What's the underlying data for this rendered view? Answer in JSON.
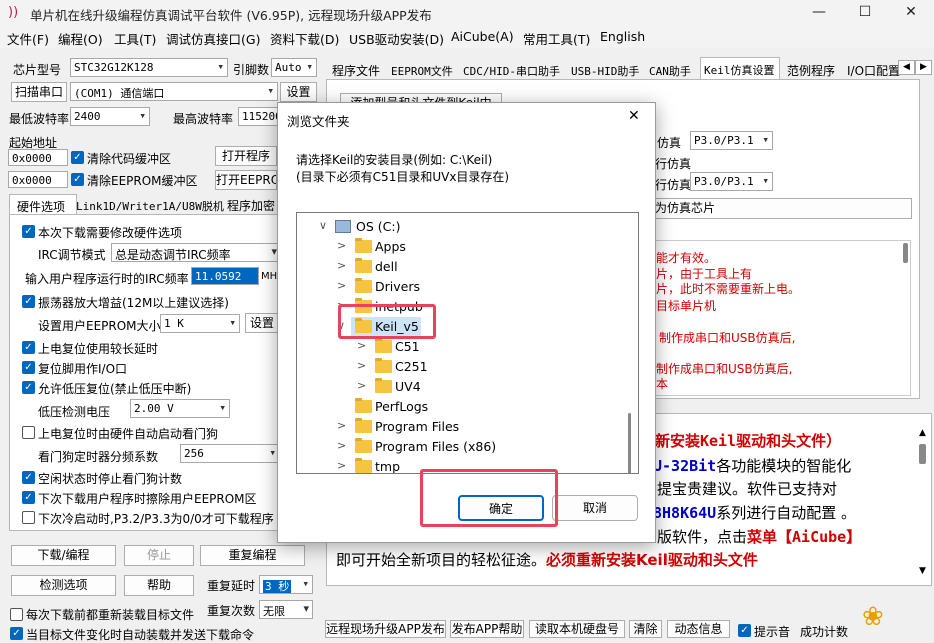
{
  "window": {
    "title": "单片机在线升级编程仿真调试平台软件 (V6.95P), 远程现场升级APP发布",
    "minimize": "—",
    "maximize": "☐",
    "close": "✕"
  },
  "menu": [
    "文件(F)",
    "编程(O)",
    "工具(T)",
    "调试仿真接口(G)",
    "资料下载(D)",
    "USB驱动安装(D)",
    "AiCube(A)",
    "常用工具(T)",
    "English"
  ],
  "left": {
    "chip_label": "芯片型号",
    "chip_value": "STC32G12K128",
    "pin_label": "引脚数",
    "pin_value": "Auto",
    "scan_button": "扫描串口",
    "port_value": "(COM1) 通信端口",
    "settings_button": "设置",
    "min_baud_label": "最低波特率",
    "min_baud": "2400",
    "max_baud_label": "最高波特率",
    "max_baud": "115200",
    "start_addr_label": "起始地址",
    "addr1": "0x0000",
    "clear_code": "清除代码缓冲区",
    "open_prog": "打开程序",
    "addr2": "0x0000",
    "clear_eeprom": "清除EEPROM缓冲区",
    "open_eeprom": "打开EEPRO",
    "tabs": [
      "硬件选项",
      "Link1D/Writer1A/U8W脱机",
      "程序加密"
    ],
    "opt_modify": "本次下载需要修改硬件选项",
    "irc_mode_label": "IRC调节模式",
    "irc_mode": "总是动态调节IRC频率",
    "irc_freq_label": "输入用户程序运行时的IRC频率",
    "irc_freq": "11.0592",
    "mhz": "MHz",
    "osc_gain": "振荡器放大增益(12M以上建议选择)",
    "eeprom_size_label": "设置用户EEPROM大小",
    "eeprom_size": "1  K",
    "eeprom_btn": "设置",
    "long_delay": "上电复位使用较长延时",
    "reset_io": "复位脚用作I/O口",
    "lvd_reset": "允许低压复位(禁止低压中断)",
    "lvd_volt_label": "低压检测电压",
    "lvd_volt": "2.00 V",
    "wdt_auto": "上电复位时由硬件自动启动看门狗",
    "wdt_div_label": "看门狗定时器分频系数",
    "wdt_div": "256",
    "idle_wdt": "空闲状态时停止看门狗计数",
    "erase_eeprom": "下次下载用户程序时擦除用户EEPROM区",
    "cold_boot": "下次冷启动时,P3.2/P3.3为0/0才可下载程序",
    "download_btn": "下载/编程",
    "stop_btn": "停止",
    "reprog_btn": "重复编程",
    "check_btn": "检测选项",
    "help_btn": "帮助",
    "repeat_delay_label": "重复延时",
    "repeat_delay": "3 秒",
    "repeat_count_label": "重复次数",
    "repeat_count": "无限",
    "reload_before": "每次下载前都重新装载目标文件",
    "auto_reload": "当目标文件变化时自动装载并发送下载命令"
  },
  "right": {
    "tabs": [
      "程序文件",
      "EEPROM文件",
      "CDC/HID-串口助手",
      "USB-HID助手",
      "CAN助手",
      "Keil仿真设置",
      "范例程序",
      "I/O口配置"
    ],
    "add_btn": "添加型号和头文件到Keil中",
    "emu_lbl1": "仿真",
    "emu_val1": "P3.0/P3.1",
    "emu_lbl2": "行仿真",
    "emu_lbl3": "行仿真",
    "emu_val3": "P3.0/P3.1",
    "set_emu": "为仿真芯片",
    "notes": [
      "能才有效。",
      "片，由于工具上有",
      "片，此时不需要重新上电。",
      "目标单片机",
      "制作成串口和USB仿真后,",
      "制作成串口和USB仿真后,",
      "本"
    ],
    "log_line1": "新安装Keil驱动和头文件）",
    "log_line2_a": "U-32Bit",
    "log_line2_b": "各功能模块的智能化",
    "log_line3": "提宝贵建议。软件已支持对",
    "log_line4_a": "8H8K64U",
    "log_line4_b": "系列进行自动配置 。",
    "log_line5_a": "版软件，点击",
    "log_line5_b": "菜单【AiCube】",
    "log_line6_a": "即可开始全新项目的轻松征途。",
    "log_line6_b": "必须重新安装Keil驱动和头文件",
    "bottom_btns": [
      "远程现场升级APP发布",
      "发布APP帮助",
      "读取本机硬盘号",
      "清除",
      "动态信息"
    ],
    "sound": "提示音",
    "success_label": "成功计数"
  },
  "dialog": {
    "title": "浏览文件夹",
    "close": "✕",
    "msg1": "请选择Keil的安装目录(例如: C:\\Keil)",
    "msg2": "(目录下必须有C51目录和UVx目录存在)",
    "tree": [
      {
        "label": "OS (C:)",
        "level": 0,
        "expanded": true,
        "drive": true
      },
      {
        "label": "Apps",
        "level": 1
      },
      {
        "label": "dell",
        "level": 1
      },
      {
        "label": "Drivers",
        "level": 1
      },
      {
        "label": "inetpub",
        "level": 1
      },
      {
        "label": "Keil_v5",
        "level": 1,
        "expanded": true,
        "selected": true
      },
      {
        "label": "C51",
        "level": 2
      },
      {
        "label": "C251",
        "level": 2
      },
      {
        "label": "UV4",
        "level": 2
      },
      {
        "label": "PerfLogs",
        "level": 1,
        "noarrow": true
      },
      {
        "label": "Program Files",
        "level": 1
      },
      {
        "label": "Program Files (x86)",
        "level": 1
      },
      {
        "label": "tmp",
        "level": 1
      }
    ],
    "ok": "确定",
    "cancel": "取消"
  },
  "colors": {
    "accent": "#0067c0",
    "red": "#d00000",
    "blue": "#0000cc",
    "highlight": "#e8425d"
  }
}
